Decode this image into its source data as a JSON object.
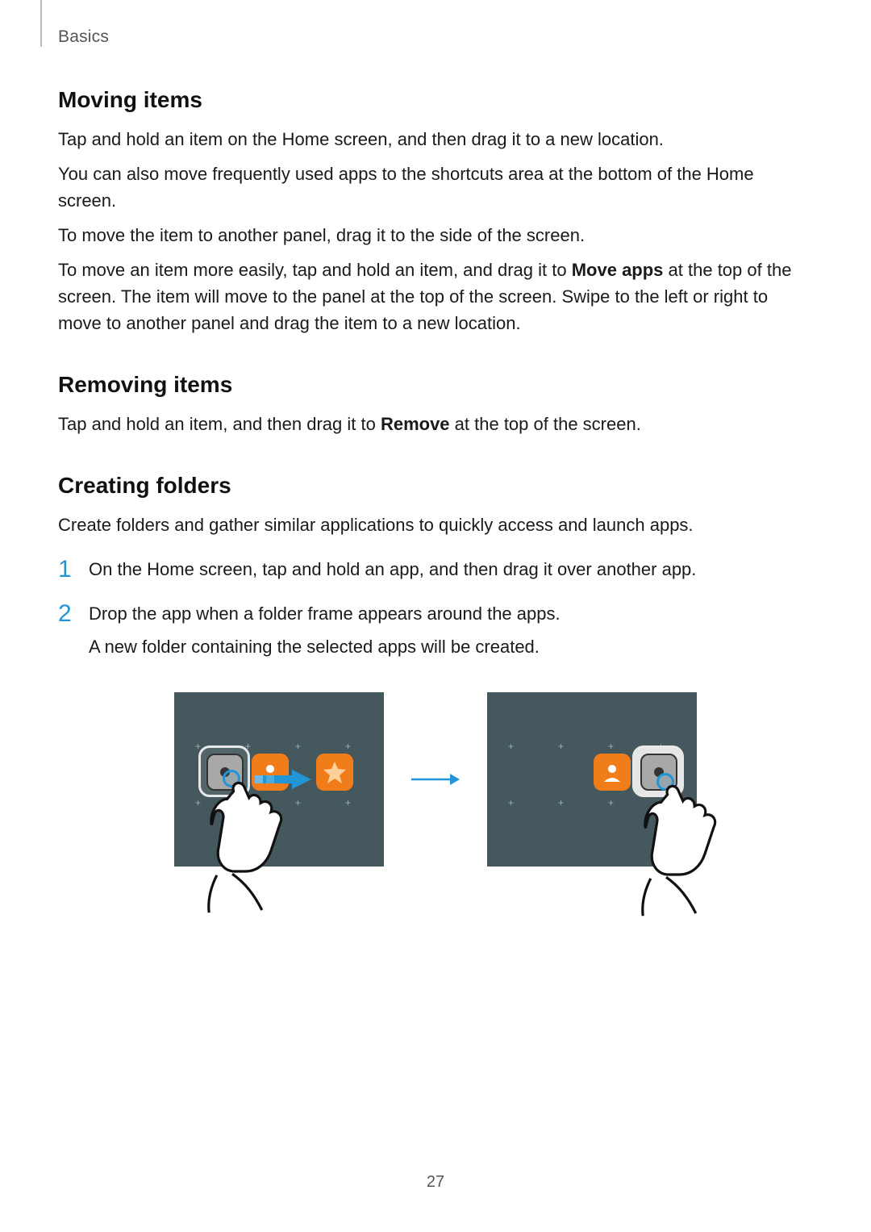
{
  "header": {
    "section": "Basics"
  },
  "sections": {
    "moving": {
      "title": "Moving items",
      "p1": "Tap and hold an item on the Home screen, and then drag it to a new location.",
      "p2": "You can also move frequently used apps to the shortcuts area at the bottom of the Home screen.",
      "p3": "To move the item to another panel, drag it to the side of the screen.",
      "p4_pre": "To move an item more easily, tap and hold an item, and drag it to ",
      "p4_bold": "Move apps",
      "p4_post": " at the top of the screen. The item will move to the panel at the top of the screen. Swipe to the left or right to move to another panel and drag the item to a new location."
    },
    "removing": {
      "title": "Removing items",
      "p1_pre": "Tap and hold an item, and then drag it to ",
      "p1_bold": "Remove",
      "p1_post": " at the top of the screen."
    },
    "folders": {
      "title": "Creating folders",
      "intro": "Create folders and gather similar applications to quickly access and launch apps.",
      "step1_num": "1",
      "step1": "On the Home screen, tap and hold an app, and then drag it over another app.",
      "step2_num": "2",
      "step2": "Drop the app when a folder frame appears around the apps.",
      "step2b": "A new folder containing the selected apps will be created."
    }
  },
  "page_number": "27"
}
